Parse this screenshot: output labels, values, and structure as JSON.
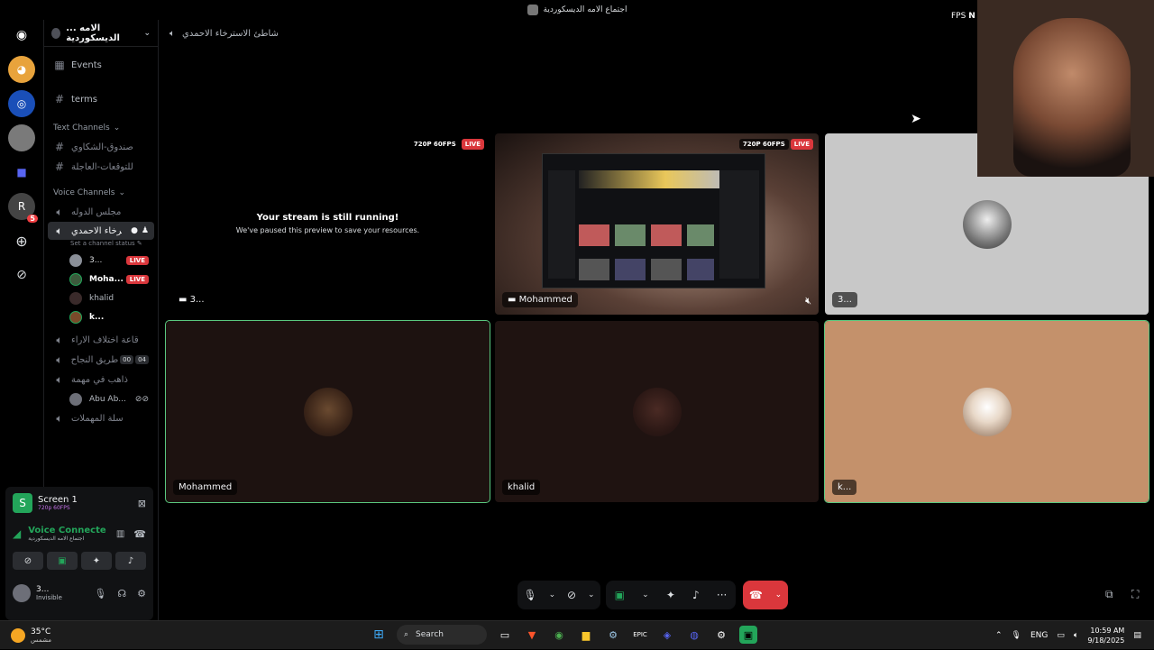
{
  "window_title": "اجتماع الامه الديسكوردية",
  "fps_label": "FPS",
  "fps_label2": "N",
  "rail": {
    "badge": "5"
  },
  "server": {
    "name": "... الامه الديسكوردية"
  },
  "channels": {
    "events": "Events",
    "terms": "terms",
    "text_category": "Text Channels",
    "text_items": [
      "صندوق-الشكاوي",
      "للتوقعات-العاجلة"
    ],
    "voice_category": "Voice Channels",
    "voice_first": "مجلس الدوله",
    "active_voice": "شاطئ الاسترخاء الاحمدي",
    "status_placeholder": "Set a channel status",
    "members": [
      {
        "name": "3...",
        "live": "LIVE",
        "color": "#8a8f98"
      },
      {
        "name": "Moha...",
        "live": "LIVE",
        "color": "#3c5a3c"
      },
      {
        "name": "khalid",
        "live": "",
        "color": "#3a2a2a"
      },
      {
        "name": "k...",
        "live": "",
        "color": "#7a4a2a"
      }
    ],
    "more_voice": [
      {
        "name": "قاعة اختلاف الاراء"
      },
      {
        "name": "طريق النجاح",
        "c1": "00",
        "c2": "04"
      },
      {
        "name": "ذاهب في مهمة"
      }
    ],
    "abu": "Abu Ab...",
    "last_voice": "سلة المهملات"
  },
  "panel": {
    "screen_title": "Screen 1",
    "screen_sub": "720p 60FPS",
    "voice_title": "Voice Connecte",
    "voice_sub": "اجتماع الامه الديسكوردية",
    "user_name": "3...",
    "user_status": "Invisible"
  },
  "header": {
    "channel": "شاطئ الاسترخاء الاحمدي"
  },
  "tiles": {
    "t1": {
      "quality": "720P 60FPS",
      "live": "LIVE",
      "paused_h": "Your stream is still running!",
      "paused_s": "We've paused this preview to save your resources.",
      "name": "3..."
    },
    "t2": {
      "quality": "720P 60FPS",
      "live": "LIVE",
      "name": "Mohammed"
    },
    "t3": {
      "name": "3..."
    },
    "t4": {
      "name": "Mohammed"
    },
    "t5": {
      "name": "khalid"
    },
    "t6": {
      "name": "k..."
    }
  },
  "taskbar": {
    "weather_temp": "35°C",
    "weather_desc": "مشمس",
    "search": "Search",
    "lang": "ENG",
    "time": "10:59 AM",
    "date": "9/18/2025"
  },
  "colors": {
    "accent_green": "#23a55a",
    "live_red": "#da373c",
    "tile_grey": "#c8c8c8",
    "tile_tan": "#c4916b"
  }
}
